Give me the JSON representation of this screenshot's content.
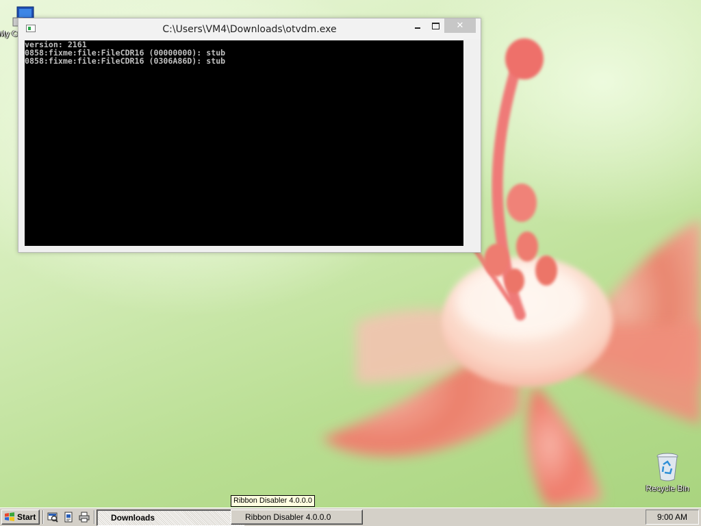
{
  "desktop": {
    "icons": [
      {
        "label": "My Computer",
        "icon": "my-computer-icon"
      },
      {
        "label": "Recycle Bin",
        "icon": "recycle-bin-icon"
      }
    ]
  },
  "console_window": {
    "title": "C:\\Users\\VM4\\Downloads\\otvdm.exe",
    "buttons": {
      "minimize": "minimize",
      "maximize": "maximize",
      "close": "close"
    },
    "lines": [
      "version: 2161",
      "0858:fixme:file:FileCDR16 (00000000): stub",
      "0858:fixme:file:FileCDR16 (0306A86D): stub"
    ]
  },
  "tooltip": {
    "text": "Ribbon Disabler 4.0.0.0"
  },
  "taskbar": {
    "start_label": "Start",
    "quick_launch": [
      {
        "icon": "show-desktop-icon"
      },
      {
        "icon": "explorer-icon"
      },
      {
        "icon": "printer-icon"
      }
    ],
    "tasks": [
      {
        "label": "Downloads",
        "active": true
      },
      {
        "label": "Ribbon Disabler 4.0.0.0",
        "active": false
      }
    ],
    "clock": "9:00 AM"
  },
  "colors": {
    "console_bg": "#000000",
    "console_text": "#c0c0c0",
    "taskbar": "#d4d0c8",
    "tooltip_bg": "#ffffe1",
    "close_button": "#c7c7c7"
  }
}
